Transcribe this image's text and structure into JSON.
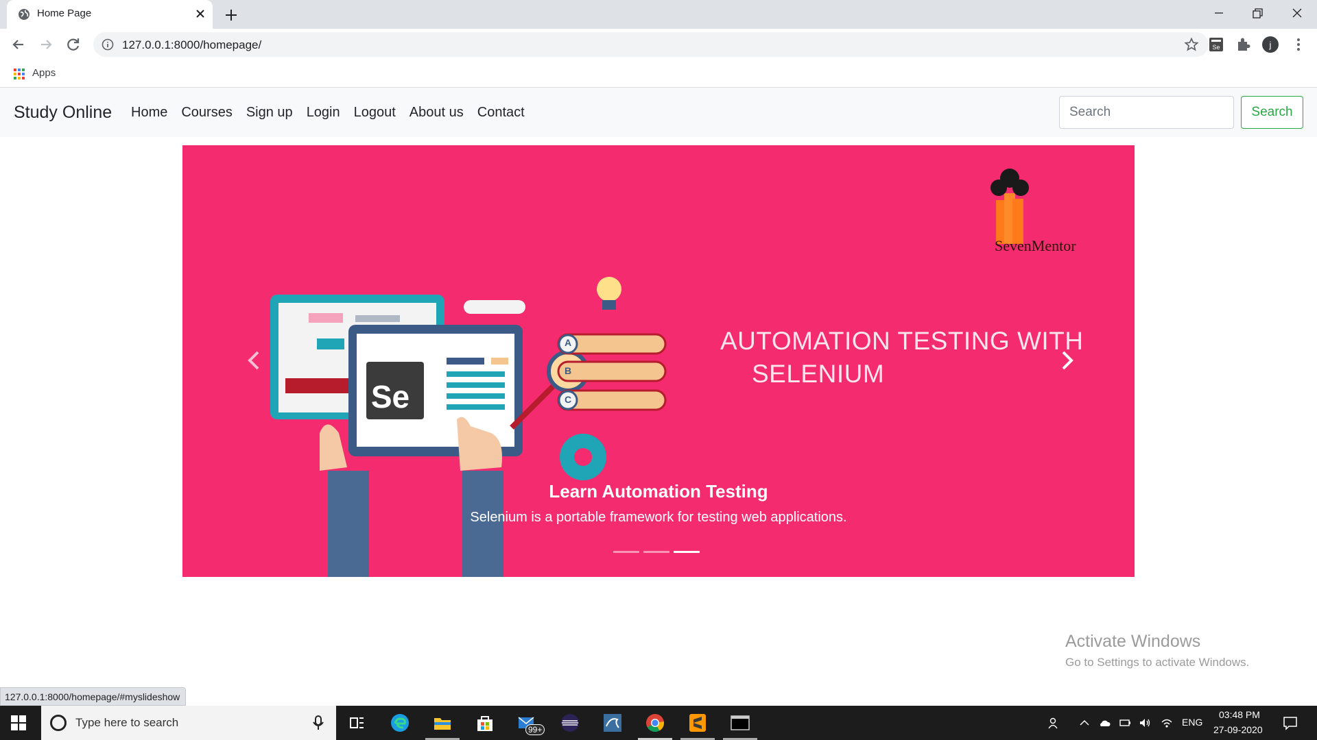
{
  "browser": {
    "tab_title": "Home Page",
    "url": "127.0.0.1:8000/homepage/",
    "bookmarks": {
      "apps_label": "Apps"
    },
    "status_url": "127.0.0.1:8000/homepage/#myslideshow"
  },
  "navbar": {
    "brand": "Study Online",
    "links": [
      "Home",
      "Courses",
      "Sign up",
      "Login",
      "Logout",
      "About us",
      "Contact"
    ],
    "search_placeholder": "Search",
    "search_button": "Search"
  },
  "carousel": {
    "background": "#f42b6f",
    "logo_text": "SevenMentor",
    "hero_line1": "AUTOMATION TESTING WITH",
    "hero_line2": "SELENIUM",
    "badge_text": "Se",
    "option_letters": [
      "A",
      "B",
      "C"
    ],
    "caption_title": "Learn Automation Testing",
    "caption_text": "Selenium is a portable framework for testing web applications.",
    "slide_count": 3,
    "active_slide": 3
  },
  "watermark": {
    "title": "Activate Windows",
    "subtitle": "Go to Settings to activate Windows."
  },
  "taskbar": {
    "search_placeholder": "Type here to search",
    "mail_badge": "99+",
    "language": "ENG",
    "time": "03:48 PM",
    "date": "27-09-2020"
  }
}
